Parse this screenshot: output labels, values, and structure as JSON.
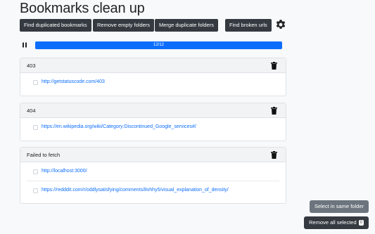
{
  "page": {
    "title": "Bookmarks clean up"
  },
  "toolbar": {
    "find_duplicates": "Find duplicated bookmarks",
    "remove_empty": "Remove empty folders",
    "merge_duplicates": "Merge duplicate folders",
    "find_broken": "Find broken urls",
    "settings_icon": "gear-icon"
  },
  "progress": {
    "label": "12/12",
    "fraction": 1.0,
    "color": "#0d6efd"
  },
  "groups": [
    {
      "title": "403",
      "links": [
        "http://getstatuscode.com/403"
      ]
    },
    {
      "title": "404",
      "links": [
        "https://en.wikipedia.org/wiki/Category:Discontinued_Google_services#/"
      ]
    },
    {
      "title": "Failed to fetch",
      "links": [
        "http://localhost:3000/",
        "https://redddit.com/r/oddlysatisfying/comments/8vhhy5/visual_explanation_of_density/"
      ]
    }
  ],
  "actions": {
    "select_same_folder": "Select in same folder",
    "remove_selected": "Remove all selected",
    "selected_count": "0"
  },
  "colors": {
    "dark": "#343a40",
    "gray_button": "#6c757d",
    "link": "#0d6efd"
  }
}
